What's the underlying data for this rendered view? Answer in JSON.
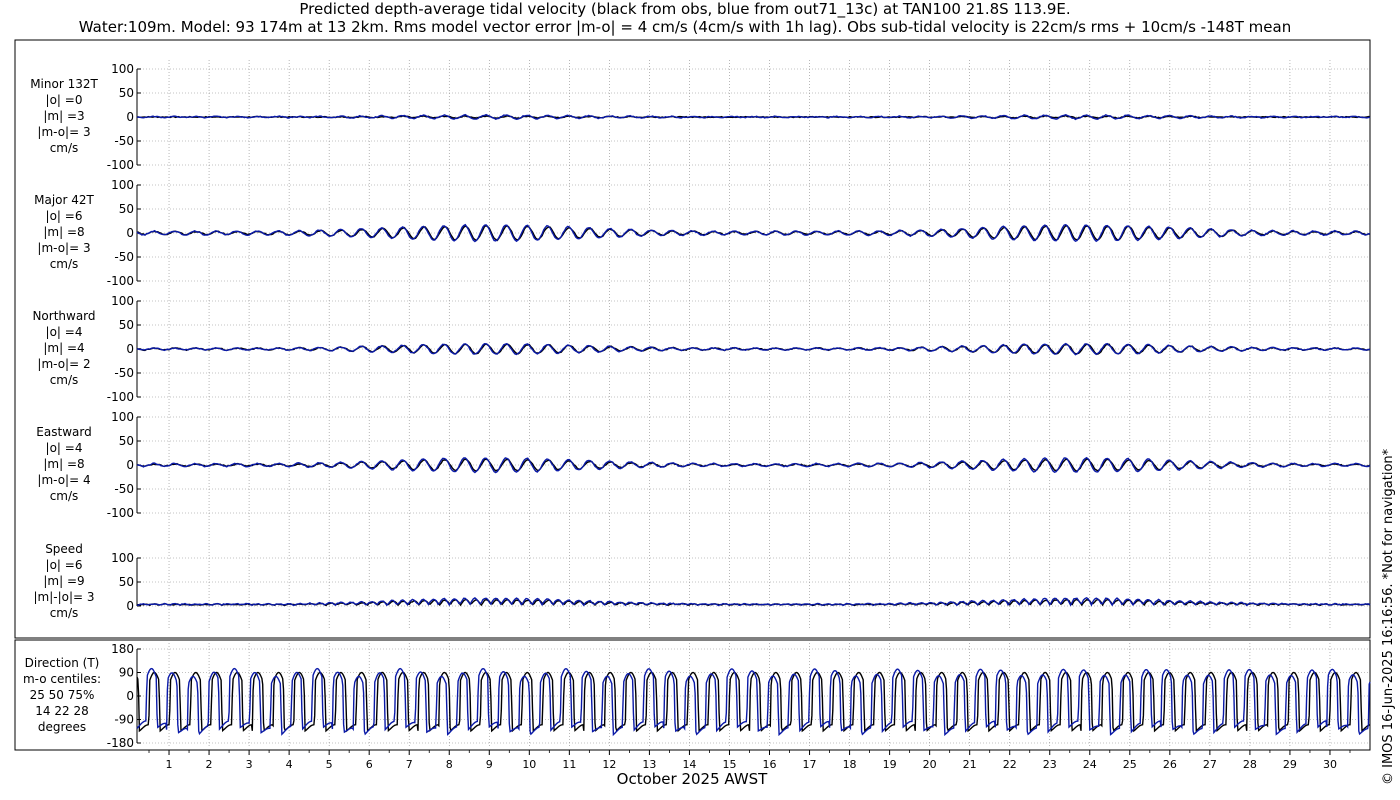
{
  "title_line1": "Predicted depth-average tidal velocity (black from obs, blue from out71_13c) at TAN100 21.8S 113.9E.",
  "title_line2": "Water:109m. Model: 93 174m at 13 2km. Rms model vector error |m-o| = 4 cm/s (4cm/s with 1h lag). Obs sub-tidal velocity is 22cm/s rms + 10cm/s -148T mean",
  "copyright": "© IMOS 16-Jun-2025 16:16:56. *Not for navigation*",
  "colors": {
    "obs": "#000000",
    "model": "#0b1aa8",
    "grid": "#888888",
    "frame": "#000000"
  },
  "chart_data": [
    {
      "type": "line",
      "panel": "minor",
      "ylabels": [
        "Minor 132T",
        "|o| =0",
        "|m| =3",
        "|m-o|= 3",
        "cm/s"
      ],
      "yticks": [
        "100",
        "50",
        "0",
        "-50",
        "-100"
      ],
      "ylim": [
        -100,
        100
      ],
      "series": [
        {
          "name": "obs",
          "color": "#000000",
          "amplitude_cm_s": [
            0,
            2
          ]
        },
        {
          "name": "model",
          "color": "#0b1aa8",
          "amplitude_cm_s": [
            1,
            4
          ]
        }
      ]
    },
    {
      "type": "line",
      "panel": "major",
      "ylabels": [
        "Major 42T",
        "|o| =6",
        "|m| =8",
        "|m-o|= 3",
        "cm/s"
      ],
      "yticks": [
        "100",
        "50",
        "0",
        "-50",
        "-100"
      ],
      "ylim": [
        -100,
        100
      ],
      "series": [
        {
          "name": "obs",
          "color": "#000000",
          "amplitude_cm_s": [
            3,
            15
          ]
        },
        {
          "name": "model",
          "color": "#0b1aa8",
          "amplitude_cm_s": [
            4,
            17
          ]
        }
      ]
    },
    {
      "type": "line",
      "panel": "north",
      "ylabels": [
        "Northward",
        "|o| =4",
        "|m| =4",
        "|m-o|= 2",
        "cm/s"
      ],
      "yticks": [
        "100",
        "50",
        "0",
        "-50",
        "-100"
      ],
      "ylim": [
        -100,
        100
      ],
      "series": [
        {
          "name": "obs",
          "color": "#000000",
          "amplitude_cm_s": [
            2,
            10
          ]
        },
        {
          "name": "model",
          "color": "#0b1aa8",
          "amplitude_cm_s": [
            2,
            11
          ]
        }
      ]
    },
    {
      "type": "line",
      "panel": "east",
      "ylabels": [
        "Eastward",
        "|o| =4",
        "|m| =8",
        "|m-o|= 4",
        "cm/s"
      ],
      "yticks": [
        "100",
        "50",
        "0",
        "-50",
        "-100"
      ],
      "ylim": [
        -100,
        100
      ],
      "series": [
        {
          "name": "obs",
          "color": "#000000",
          "amplitude_cm_s": [
            2,
            12
          ]
        },
        {
          "name": "model",
          "color": "#0b1aa8",
          "amplitude_cm_s": [
            3,
            15
          ]
        }
      ]
    },
    {
      "type": "line",
      "panel": "speed",
      "ylabels": [
        "Speed",
        "|o| =6",
        "|m| =9",
        "|m|-|o|= 3",
        "cm/s"
      ],
      "yticks": [
        "100",
        "50",
        "0"
      ],
      "ylim": [
        0,
        100
      ],
      "series": [
        {
          "name": "obs",
          "color": "#000000",
          "amplitude_cm_s": [
            2,
            14
          ]
        },
        {
          "name": "model",
          "color": "#0b1aa8",
          "amplitude_cm_s": [
            3,
            18
          ]
        }
      ]
    },
    {
      "type": "line",
      "panel": "direction",
      "ylabels": [
        "Direction (T)",
        "m-o centiles:",
        "25  50  75%",
        "14  22  28",
        "degrees"
      ],
      "yticks": [
        "180",
        "90",
        "0",
        "-90",
        "-180"
      ],
      "ylim": [
        -180,
        180
      ],
      "series": [
        {
          "name": "obs",
          "color": "#000000"
        },
        {
          "name": "model",
          "color": "#0b1aa8"
        }
      ]
    }
  ],
  "x_axis": {
    "label": "October 2025 AWST",
    "tick_labels": [
      "1",
      "2",
      "3",
      "4",
      "5",
      "6",
      "7",
      "8",
      "9",
      "10",
      "11",
      "12",
      "13",
      "14",
      "15",
      "16",
      "17",
      "18",
      "19",
      "20",
      "21",
      "22",
      "23",
      "24",
      "25",
      "26",
      "27",
      "28",
      "29",
      "30"
    ],
    "range_days": [
      0.2,
      31
    ]
  }
}
